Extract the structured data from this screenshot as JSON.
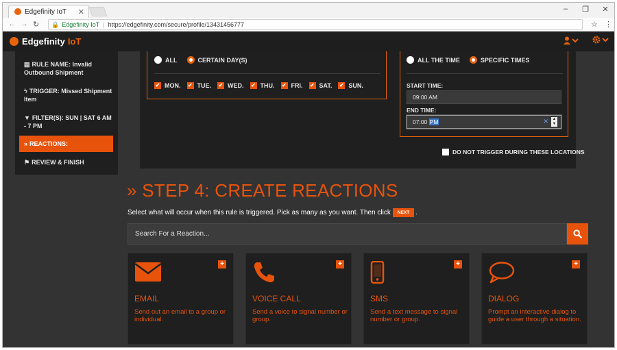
{
  "browser": {
    "tab_title": "Edgefinity IoT",
    "omnibox_site": "Edgefinity IoT",
    "url": "https://edgefinity.com/secure/profile/13431456777"
  },
  "app": {
    "brand_name": "Edgefinity",
    "brand_suffix": "IoT"
  },
  "sidebar": {
    "items": [
      {
        "label": "RULE NAME: Invalid Outbound Shipment",
        "icon": "id-card-icon"
      },
      {
        "label": "TRIGGER: Missed Shipment Item",
        "icon": "bolt-icon"
      },
      {
        "label": "FILTER(S): SUN | SAT 6 AM - 7 PM",
        "icon": "filter-icon"
      },
      {
        "label": "REACTIONS:",
        "icon": "double-chevron-icon",
        "active": true
      },
      {
        "label": "REVIEW & FINISH",
        "icon": "flag-icon"
      }
    ]
  },
  "days_panel": {
    "option_all": "ALL",
    "option_certain": "CERTAIN DAY(S)",
    "days": [
      "MON.",
      "TUE.",
      "WED.",
      "THU.",
      "FRI.",
      "SAT.",
      "SUN."
    ]
  },
  "time_panel": {
    "option_all_time": "ALL THE TIME",
    "option_specific": "SPECIFIC TIMES",
    "start_label": "START TIME:",
    "start_value": "09:00 AM",
    "end_label": "END TIME:",
    "end_value_time": "07:00",
    "end_value_meridiem": "PM"
  },
  "no_locations_label": "DO NOT TRIGGER DURING THESE LOCATIONS",
  "step": {
    "title": "» STEP 4: CREATE REACTIONS",
    "instruction_before": "Select what will occur when this rule is triggered. Pick as many as you want. Then click",
    "next_label": "NEXT",
    "instruction_after": "."
  },
  "search": {
    "placeholder": "Search For a Reaction..."
  },
  "reactions": [
    {
      "title": "EMAIL",
      "description": "Send out an email to a group or individual.",
      "icon": "envelope-icon"
    },
    {
      "title": "VOICE CALL",
      "description": "Send a voice to signal number or group.",
      "icon": "phone-icon"
    },
    {
      "title": "SMS",
      "description": "Send a text message to signal number or group.",
      "icon": "mobile-icon"
    },
    {
      "title": "DIALOG",
      "description": "Prompt an interactive dialog to guide a user through a situation.",
      "icon": "speech-bubble-icon"
    }
  ],
  "colors": {
    "accent": "#e8530c",
    "app_bg": "#333333",
    "panel_bg": "#1f1f1f"
  }
}
